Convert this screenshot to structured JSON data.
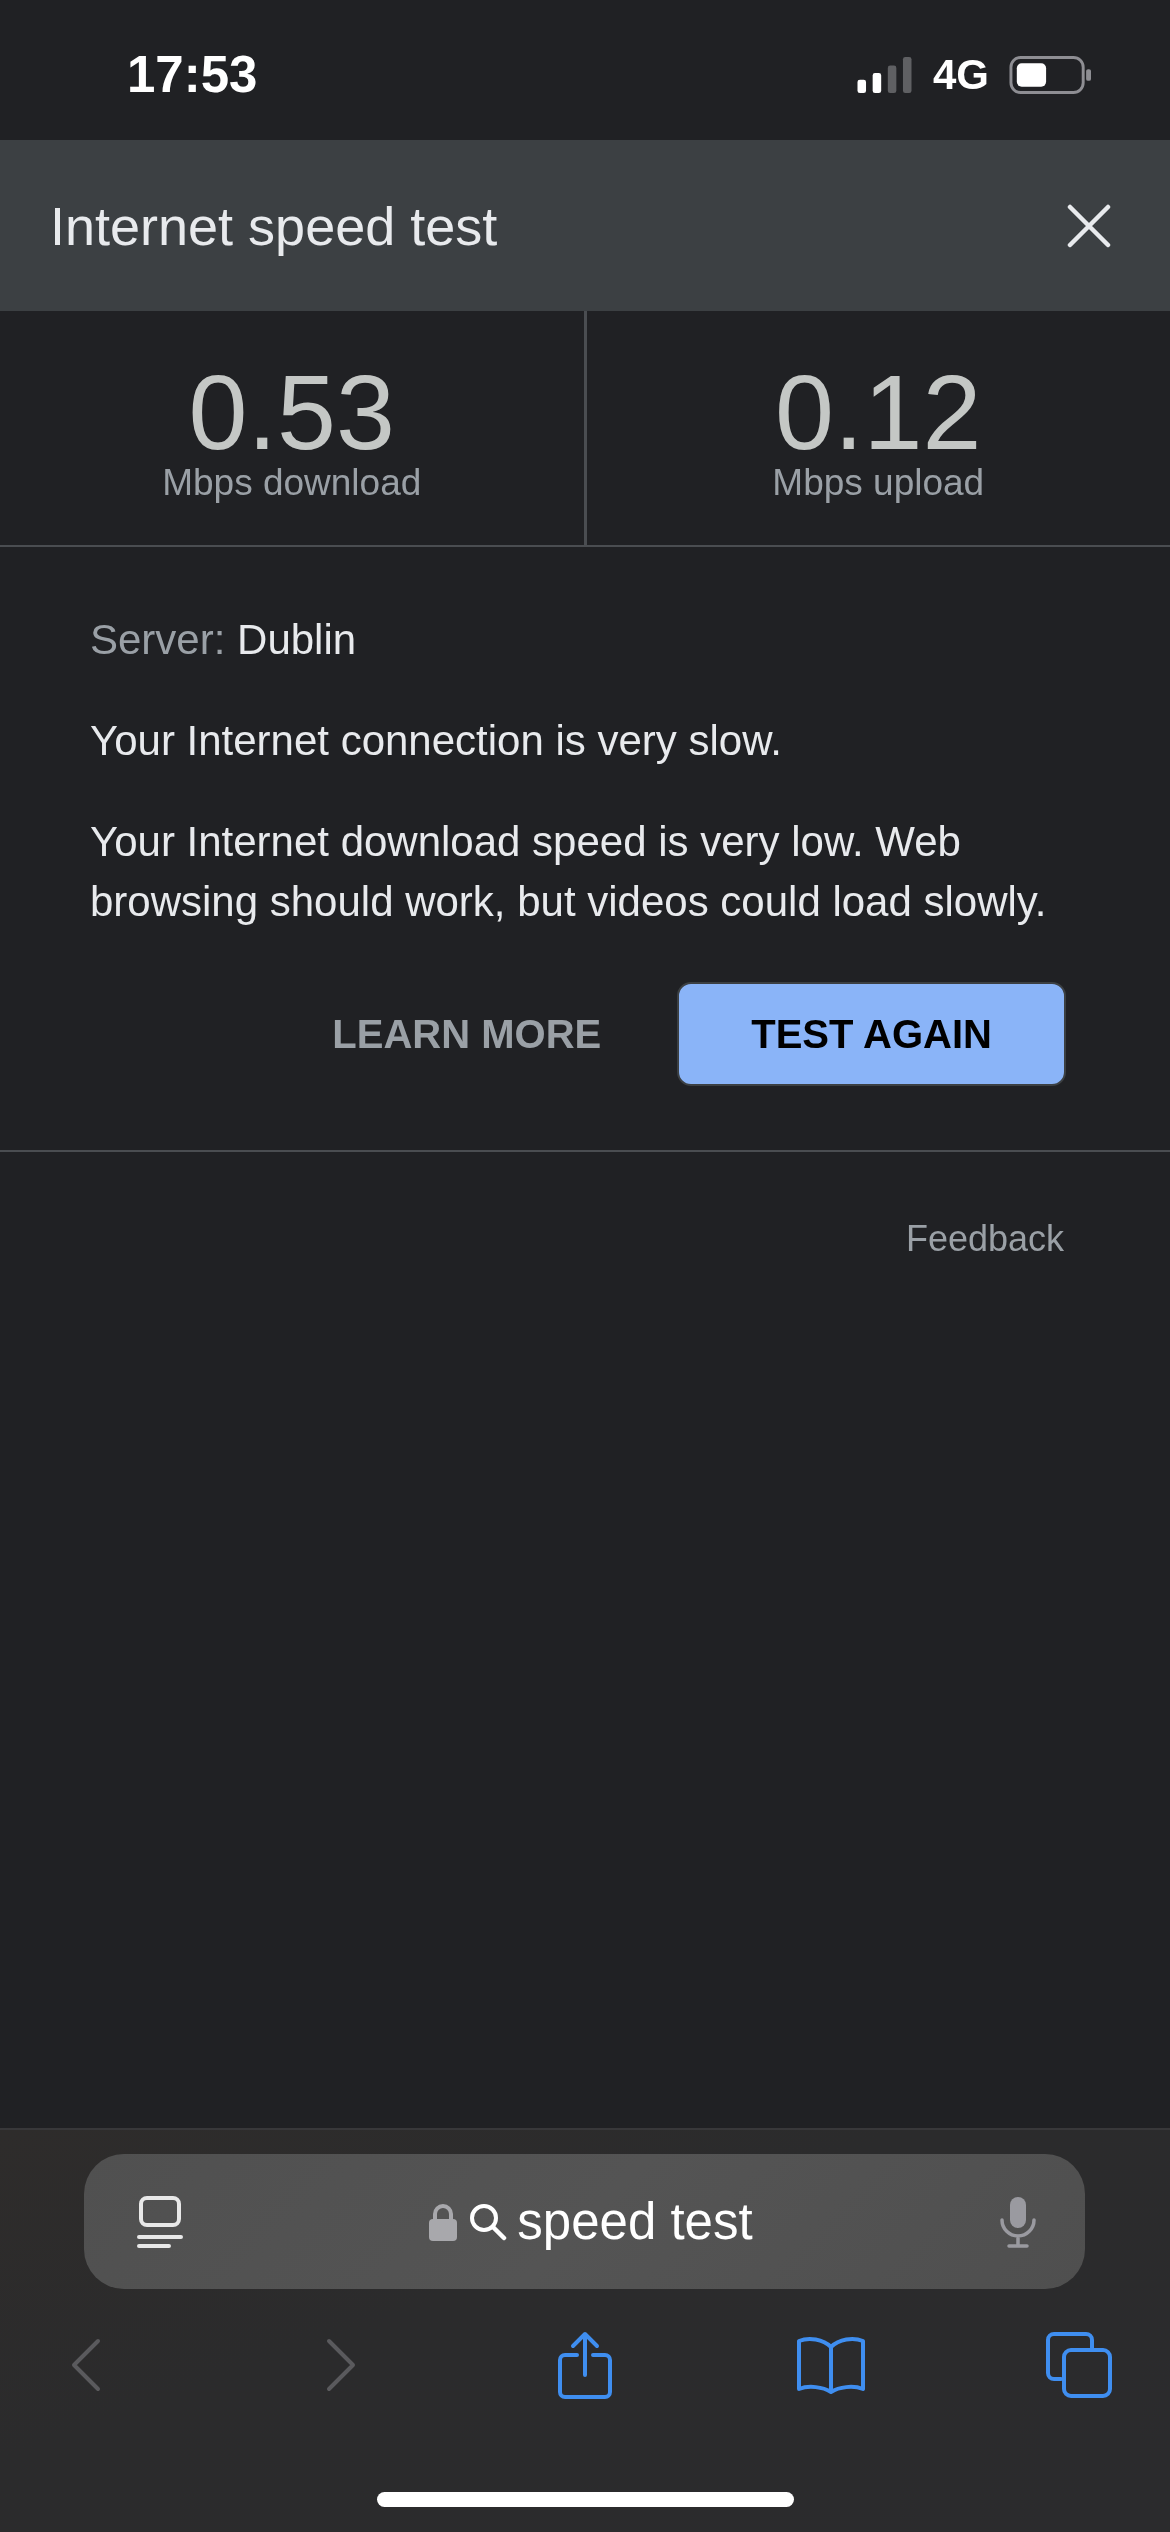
{
  "status_bar": {
    "time": "17:53",
    "network": "4G"
  },
  "panel": {
    "title": "Internet speed test"
  },
  "results": [
    {
      "value": "0.53",
      "label": "Mbps download"
    },
    {
      "value": "0.12",
      "label": "Mbps upload"
    }
  ],
  "details": {
    "server_label": "Server:",
    "server": "Dublin",
    "summary": "Your Internet connection is very slow.",
    "description": "Your Internet download speed is very low. Web browsing should work, but videos could load slowly."
  },
  "actions": [
    {
      "kind": "text",
      "label": "LEARN MORE"
    },
    {
      "kind": "filled",
      "label": "TEST AGAIN"
    }
  ],
  "feedback": "Feedback",
  "browser": {
    "address_bar": {
      "value": "speed test"
    },
    "toolbar": [
      {
        "kind": "back",
        "disabled": true
      },
      {
        "kind": "forward",
        "disabled": true
      },
      {
        "kind": "share",
        "disabled": false
      },
      {
        "kind": "bookmarks",
        "disabled": false
      },
      {
        "kind": "tabs",
        "disabled": false
      }
    ]
  }
}
